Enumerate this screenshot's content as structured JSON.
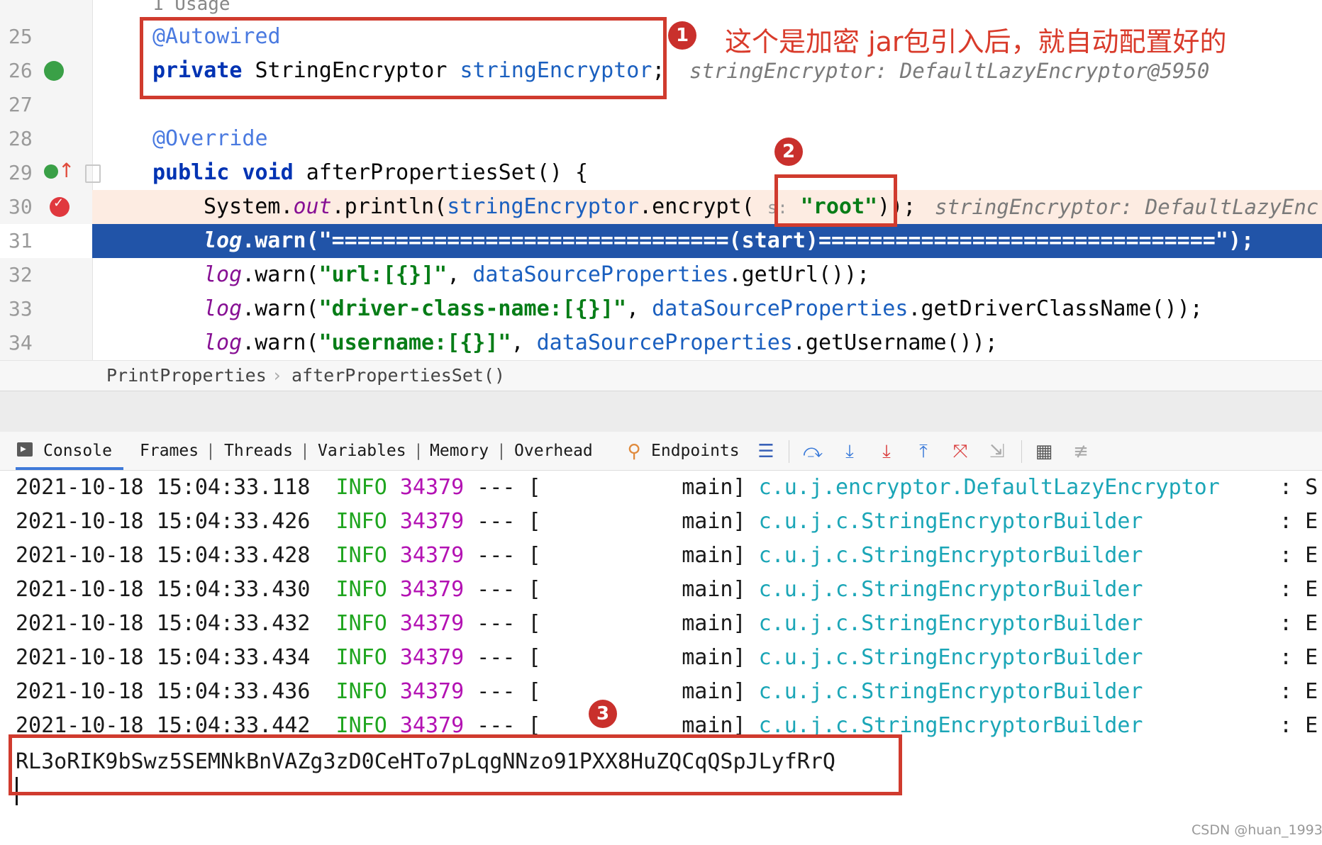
{
  "editor": {
    "usages": "1 Usage",
    "lines": [
      {
        "num": "25",
        "anno": "@Autowired"
      },
      {
        "num": "26",
        "kw": "private",
        "type": " StringEncryptor ",
        "field": "stringEncryptor",
        "end": ";",
        "hint": "stringEncryptor: DefaultLazyEncryptor@5950"
      },
      {
        "num": "27"
      },
      {
        "num": "28",
        "anno": "@Override"
      },
      {
        "num": "29",
        "kw1": "public",
        "kw2": "void",
        "rest": " afterPropertiesSet() {"
      },
      {
        "num": "30",
        "p1": "System.",
        "out": "out",
        "p2": ".println(",
        "field": "stringEncryptor",
        "p3": ".encrypt(",
        "param": "s:",
        "str": "\"root\"",
        "p4": "));",
        "hint": "stringEncryptor: DefaultLazyEnc"
      },
      {
        "num": "31",
        "log": "log",
        "p1": ".warn(",
        "str": "\"===============================(start)===============================\"",
        "p2": ");"
      },
      {
        "num": "32",
        "log": "log",
        "p1": ".warn(",
        "str": "\"url:[{}]\"",
        "p2": ", ",
        "field": "dataSourceProperties",
        "p3": ".getUrl());"
      },
      {
        "num": "33",
        "log": "log",
        "p1": ".warn(",
        "str": "\"driver-class-name:[{}]\"",
        "p2": ", ",
        "field": "dataSourceProperties",
        "p3": ".getDriverClassName());"
      },
      {
        "num": "34",
        "log": "log",
        "p1": ".warn(",
        "str": "\"username:[{}]\"",
        "p2": ", ",
        "field": "dataSourceProperties",
        "p3": ".getUsername());"
      }
    ]
  },
  "annotations": {
    "badge1": "1",
    "badge2": "2",
    "badge3": "3",
    "note": "这个是加密 jar包引入后，就自动配置好的"
  },
  "breadcrumb": {
    "class_name": "PrintProperties",
    "separator": "›",
    "method": "afterPropertiesSet()"
  },
  "toolbar": {
    "console": "Console",
    "frames": "Frames",
    "threads": "Threads",
    "variables": "Variables",
    "memory": "Memory",
    "overhead": "Overhead",
    "endpoints": "Endpoints",
    "sep": "|"
  },
  "console": {
    "logs": [
      {
        "ts": "2021-10-18 15:04:33.118",
        "level": "INFO",
        "pid": "34379",
        "dash": "---",
        "thread": "[           main]",
        "cls": "c.u.j.encryptor.DefaultLazyEncryptor",
        "msg": ": S"
      },
      {
        "ts": "2021-10-18 15:04:33.426",
        "level": "INFO",
        "pid": "34379",
        "dash": "---",
        "thread": "[           main]",
        "cls": "c.u.j.c.StringEncryptorBuilder",
        "msg": ": E"
      },
      {
        "ts": "2021-10-18 15:04:33.428",
        "level": "INFO",
        "pid": "34379",
        "dash": "---",
        "thread": "[           main]",
        "cls": "c.u.j.c.StringEncryptorBuilder",
        "msg": ": E"
      },
      {
        "ts": "2021-10-18 15:04:33.430",
        "level": "INFO",
        "pid": "34379",
        "dash": "---",
        "thread": "[           main]",
        "cls": "c.u.j.c.StringEncryptorBuilder",
        "msg": ": E"
      },
      {
        "ts": "2021-10-18 15:04:33.432",
        "level": "INFO",
        "pid": "34379",
        "dash": "---",
        "thread": "[           main]",
        "cls": "c.u.j.c.StringEncryptorBuilder",
        "msg": ": E"
      },
      {
        "ts": "2021-10-18 15:04:33.434",
        "level": "INFO",
        "pid": "34379",
        "dash": "---",
        "thread": "[           main]",
        "cls": "c.u.j.c.StringEncryptorBuilder",
        "msg": ": E"
      },
      {
        "ts": "2021-10-18 15:04:33.436",
        "level": "INFO",
        "pid": "34379",
        "dash": "---",
        "thread": "[           main]",
        "cls": "c.u.j.c.StringEncryptorBuilder",
        "msg": ": E"
      },
      {
        "ts": "2021-10-18 15:04:33.442",
        "level": "INFO",
        "pid": "34379",
        "dash": "---",
        "thread": "[           main]",
        "cls": "c.u.j.c.StringEncryptorBuilder",
        "msg": ": E"
      }
    ],
    "cipher": "RL3oRIK9bSwz5SEMNkBnVAZg3zD0CeHTo7pLqgNNzo91PXX8HuZQCqQSpJLyfRrQ"
  },
  "watermark": "CSDN @huan_1993",
  "colors": {
    "highlight": "#2154a8",
    "box": "#d03b2e",
    "breakpoint_line": "#fdece2"
  }
}
